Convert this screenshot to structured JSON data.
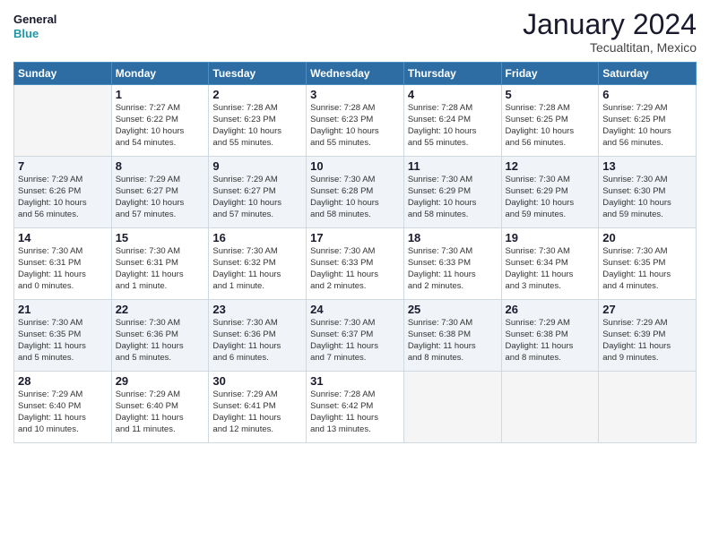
{
  "logo": {
    "line1": "General",
    "line2": "Blue"
  },
  "title": "January 2024",
  "location": "Tecualtitan, Mexico",
  "days_header": [
    "Sunday",
    "Monday",
    "Tuesday",
    "Wednesday",
    "Thursday",
    "Friday",
    "Saturday"
  ],
  "weeks": [
    [
      {
        "num": "",
        "info": ""
      },
      {
        "num": "1",
        "info": "Sunrise: 7:27 AM\nSunset: 6:22 PM\nDaylight: 10 hours\nand 54 minutes."
      },
      {
        "num": "2",
        "info": "Sunrise: 7:28 AM\nSunset: 6:23 PM\nDaylight: 10 hours\nand 55 minutes."
      },
      {
        "num": "3",
        "info": "Sunrise: 7:28 AM\nSunset: 6:23 PM\nDaylight: 10 hours\nand 55 minutes."
      },
      {
        "num": "4",
        "info": "Sunrise: 7:28 AM\nSunset: 6:24 PM\nDaylight: 10 hours\nand 55 minutes."
      },
      {
        "num": "5",
        "info": "Sunrise: 7:28 AM\nSunset: 6:25 PM\nDaylight: 10 hours\nand 56 minutes."
      },
      {
        "num": "6",
        "info": "Sunrise: 7:29 AM\nSunset: 6:25 PM\nDaylight: 10 hours\nand 56 minutes."
      }
    ],
    [
      {
        "num": "7",
        "info": "Sunrise: 7:29 AM\nSunset: 6:26 PM\nDaylight: 10 hours\nand 56 minutes."
      },
      {
        "num": "8",
        "info": "Sunrise: 7:29 AM\nSunset: 6:27 PM\nDaylight: 10 hours\nand 57 minutes."
      },
      {
        "num": "9",
        "info": "Sunrise: 7:29 AM\nSunset: 6:27 PM\nDaylight: 10 hours\nand 57 minutes."
      },
      {
        "num": "10",
        "info": "Sunrise: 7:30 AM\nSunset: 6:28 PM\nDaylight: 10 hours\nand 58 minutes."
      },
      {
        "num": "11",
        "info": "Sunrise: 7:30 AM\nSunset: 6:29 PM\nDaylight: 10 hours\nand 58 minutes."
      },
      {
        "num": "12",
        "info": "Sunrise: 7:30 AM\nSunset: 6:29 PM\nDaylight: 10 hours\nand 59 minutes."
      },
      {
        "num": "13",
        "info": "Sunrise: 7:30 AM\nSunset: 6:30 PM\nDaylight: 10 hours\nand 59 minutes."
      }
    ],
    [
      {
        "num": "14",
        "info": "Sunrise: 7:30 AM\nSunset: 6:31 PM\nDaylight: 11 hours\nand 0 minutes."
      },
      {
        "num": "15",
        "info": "Sunrise: 7:30 AM\nSunset: 6:31 PM\nDaylight: 11 hours\nand 1 minute."
      },
      {
        "num": "16",
        "info": "Sunrise: 7:30 AM\nSunset: 6:32 PM\nDaylight: 11 hours\nand 1 minute."
      },
      {
        "num": "17",
        "info": "Sunrise: 7:30 AM\nSunset: 6:33 PM\nDaylight: 11 hours\nand 2 minutes."
      },
      {
        "num": "18",
        "info": "Sunrise: 7:30 AM\nSunset: 6:33 PM\nDaylight: 11 hours\nand 2 minutes."
      },
      {
        "num": "19",
        "info": "Sunrise: 7:30 AM\nSunset: 6:34 PM\nDaylight: 11 hours\nand 3 minutes."
      },
      {
        "num": "20",
        "info": "Sunrise: 7:30 AM\nSunset: 6:35 PM\nDaylight: 11 hours\nand 4 minutes."
      }
    ],
    [
      {
        "num": "21",
        "info": "Sunrise: 7:30 AM\nSunset: 6:35 PM\nDaylight: 11 hours\nand 5 minutes."
      },
      {
        "num": "22",
        "info": "Sunrise: 7:30 AM\nSunset: 6:36 PM\nDaylight: 11 hours\nand 5 minutes."
      },
      {
        "num": "23",
        "info": "Sunrise: 7:30 AM\nSunset: 6:36 PM\nDaylight: 11 hours\nand 6 minutes."
      },
      {
        "num": "24",
        "info": "Sunrise: 7:30 AM\nSunset: 6:37 PM\nDaylight: 11 hours\nand 7 minutes."
      },
      {
        "num": "25",
        "info": "Sunrise: 7:30 AM\nSunset: 6:38 PM\nDaylight: 11 hours\nand 8 minutes."
      },
      {
        "num": "26",
        "info": "Sunrise: 7:29 AM\nSunset: 6:38 PM\nDaylight: 11 hours\nand 8 minutes."
      },
      {
        "num": "27",
        "info": "Sunrise: 7:29 AM\nSunset: 6:39 PM\nDaylight: 11 hours\nand 9 minutes."
      }
    ],
    [
      {
        "num": "28",
        "info": "Sunrise: 7:29 AM\nSunset: 6:40 PM\nDaylight: 11 hours\nand 10 minutes."
      },
      {
        "num": "29",
        "info": "Sunrise: 7:29 AM\nSunset: 6:40 PM\nDaylight: 11 hours\nand 11 minutes."
      },
      {
        "num": "30",
        "info": "Sunrise: 7:29 AM\nSunset: 6:41 PM\nDaylight: 11 hours\nand 12 minutes."
      },
      {
        "num": "31",
        "info": "Sunrise: 7:28 AM\nSunset: 6:42 PM\nDaylight: 11 hours\nand 13 minutes."
      },
      {
        "num": "",
        "info": ""
      },
      {
        "num": "",
        "info": ""
      },
      {
        "num": "",
        "info": ""
      }
    ]
  ]
}
